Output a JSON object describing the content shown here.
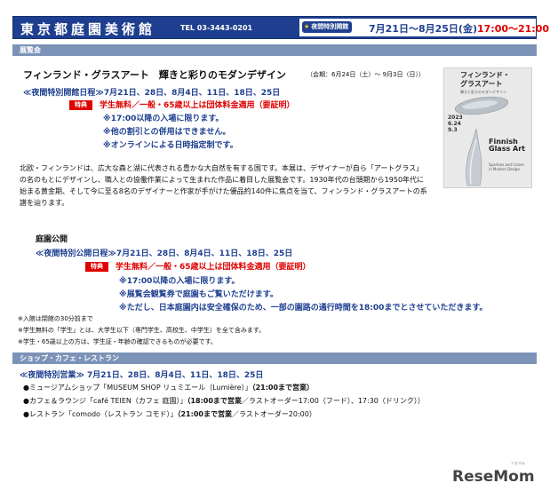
{
  "header": {
    "title": "東京都庭園美術館",
    "tel": "TEL 03-3443-0201",
    "badge": "夜間特別開館",
    "dates": "7月21日～8月25日(金)",
    "time": "17:00～21:00"
  },
  "exhibition": {
    "section_label": "展覧会",
    "title": "フィンランド・グラスアート　輝きと彩りのモダンデザイン",
    "period": "（会期：6月24日（土）～ 9月3日（日））",
    "schedule": "≪夜間特別開館日程≫7月21日、28日、8月4日、11日、18日、25日",
    "tag": "特典",
    "benefit": "学生無料／一般・65歳以上は団体料金適用（要証明）",
    "notes": [
      "※17:00以降の入場に限ります。",
      "※他の割引との併用はできません。",
      "※オンラインによる日時指定制です。"
    ],
    "description": "北欧・フィンランドは、広大な森と湖に代表される豊かな大自然を有する国です。本展は、デザイナーが自ら「アートグラス」の名のもとにデザインし、職人との協働作業によって生まれた作品に着目した展覧会です。1930年代の台頭期から1950年代に始まる黄金期、そして今に至る8名のデザイナーと作家が手がけた優品約140件に焦点を当て、フィンランド・グラスアートの系譜を辿ります。",
    "poster": {
      "title_line1": "フィンランド・",
      "title_line2": "グラスアート",
      "subtitle": "輝きと彩りのモダンデザイン",
      "year": "2023",
      "date1": "6.24",
      "date2": "9.3",
      "en_line1": "Finnish",
      "en_line2": "Glass Art",
      "en_sub1": "Sparkles and Colors",
      "en_sub2": "in Modern Design"
    }
  },
  "garden": {
    "title": "庭園公開",
    "schedule": "≪夜間特別公開日程≫7月21日、28日、8月4日、11日、18日、25日",
    "tag": "特典",
    "benefit": "学生無料／一般・65歳以上は団体料金適用（要証明）",
    "notes": [
      "※17:00以降の入場に限ります。",
      "※展覧会観覧券で庭園もご覧いただけます。",
      "※ただし、日本庭園内は安全確保のため、一部の園路の通行時間を18:00までとさせていただきます。"
    ]
  },
  "footnotes": [
    "※入館は閉館の30分前まで",
    "※学生無料の「学生」とは、大学生以下（専門学生、高校生、中学生）を全て含みます。",
    "※学生・65歳以上の方は、学生証・年齢の確認できるものが必要です。"
  ],
  "shop": {
    "section_label": "ショップ・カフェ・レストラン",
    "schedule": "≪夜間特別営業≫ 7月21日、28日、8月4日、11日、18日、25日",
    "items": [
      {
        "text": "●ミュージアムショップ「MUSEUM SHOP リュミエール（Lumière）」",
        "hours": "（21:00まで営業）",
        "extra": ""
      },
      {
        "text": "●カフェ＆ラウンジ「café TEIEN（カフェ 庭園）」",
        "hours": "（18:00まで営業",
        "extra": "／ラストオーダー17:00（フード）、17:30（ドリンク））"
      },
      {
        "text": "●レストラン「comodo（レストラン コモド）」",
        "hours": "（21:00まで営業",
        "extra": "／ラストオーダー20:00）"
      }
    ]
  },
  "logo": {
    "text": "ReseMom",
    "ruby": "リセマム"
  },
  "colors": {
    "header_blue": "#1e3f8f",
    "section_bar": "#7c93b8",
    "accent_red": "#e00000"
  }
}
